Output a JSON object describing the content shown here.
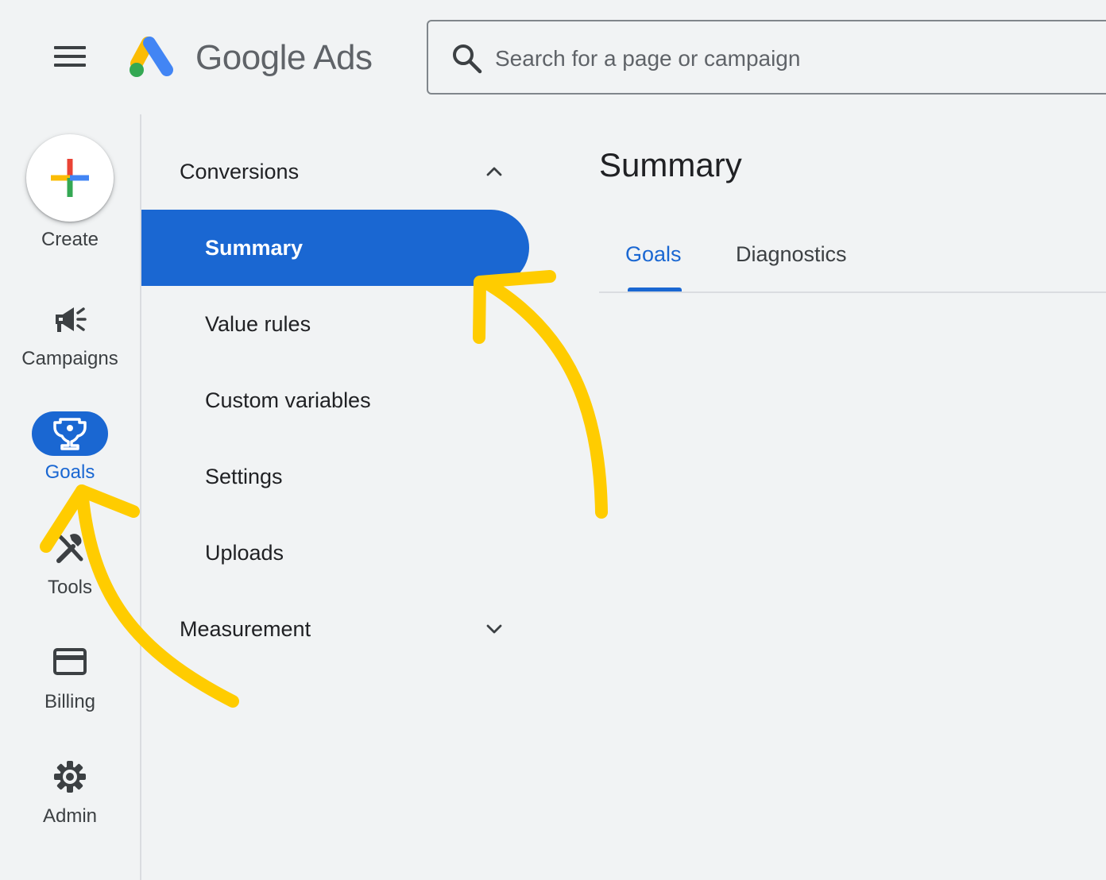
{
  "header": {
    "product_name": "Google Ads",
    "search_placeholder": "Search for a page or campaign",
    "search_value": ""
  },
  "rail": {
    "create_label": "Create",
    "items": [
      {
        "label": "Campaigns",
        "icon": "megaphone-icon"
      },
      {
        "label": "Goals",
        "icon": "trophy-icon",
        "active": true
      },
      {
        "label": "Tools",
        "icon": "tools-icon"
      },
      {
        "label": "Billing",
        "icon": "credit-card-icon"
      },
      {
        "label": "Admin",
        "icon": "gear-icon"
      }
    ]
  },
  "nav": {
    "conversions_label": "Conversions",
    "conversions_expanded": true,
    "items": [
      {
        "label": "Summary",
        "active": true
      },
      {
        "label": "Value rules"
      },
      {
        "label": "Custom variables"
      },
      {
        "label": "Settings"
      },
      {
        "label": "Uploads"
      }
    ],
    "measurement_label": "Measurement",
    "measurement_expanded": false
  },
  "main": {
    "title": "Summary",
    "tabs": [
      {
        "label": "Goals",
        "active": true
      },
      {
        "label": "Diagnostics"
      }
    ]
  },
  "colors": {
    "accent": "#1a67d2",
    "background": "#f1f3f4",
    "annotation": "#ffcc00"
  }
}
